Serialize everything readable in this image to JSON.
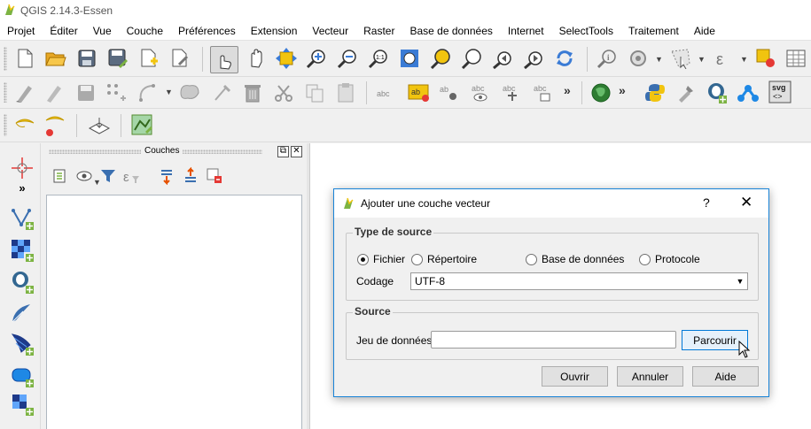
{
  "window": {
    "title": "QGIS 2.14.3-Essen"
  },
  "menubar": {
    "items": [
      "Projet",
      "Éditer",
      "Vue",
      "Couche",
      "Préférences",
      "Extension",
      "Vecteur",
      "Raster",
      "Base de données",
      "Internet",
      "SelectTools",
      "Traitement",
      "Aide"
    ]
  },
  "toolbar1": {
    "icons": [
      "new-project-icon",
      "open-project-icon",
      "save-project-icon",
      "save-as-icon",
      "new-print-composer-icon",
      "composer-manager-icon",
      "touch-zoom-icon",
      "pan-icon",
      "pan-to-selection-icon",
      "zoom-in-icon",
      "zoom-out-icon",
      "zoom-native-icon",
      "zoom-full-icon",
      "zoom-selection-icon",
      "zoom-layer-icon",
      "zoom-last-icon",
      "zoom-next-icon",
      "refresh-icon",
      "identify-icon",
      "action-icon",
      "select-icon",
      "measure-icon",
      "annotation-icon",
      "attribute-table-icon"
    ]
  },
  "toolbar2": {
    "icons": [
      "current-edits-icon",
      "toggle-editing-icon",
      "save-edits-icon",
      "add-feature-icon",
      "move-feature-icon",
      "node-tool-icon",
      "delete-selected-icon",
      "cut-features-icon",
      "copy-features-icon",
      "paste-features-icon",
      "label-icon",
      "label-highlight-icon",
      "pin-label-icon",
      "show-hide-label-icon",
      "move-label-icon",
      "change-label-icon",
      "globe-icon",
      "python-icon",
      "plugin-icon",
      "postgis-icon",
      "network-icon",
      "svg-icon"
    ],
    "svg_label": "svg"
  },
  "toolbar3": {
    "icons": [
      "add-ring-icon",
      "add-part-icon",
      "digitize-icon",
      "georeferencer-icon"
    ]
  },
  "left_toolbar": {
    "icons": [
      "crosshair-icon",
      "expand-icon",
      "add-vector-layer-icon",
      "add-raster-layer-icon",
      "add-postgis-layer-icon",
      "add-spatialite-layer-icon",
      "add-wms-layer-icon",
      "add-wfs-layer-icon",
      "add-virtual-layer-icon"
    ]
  },
  "layers_panel": {
    "title": "Couches",
    "icons": [
      "add-group-icon",
      "manage-visibility-icon",
      "filter-legend-icon",
      "filter-expression-icon",
      "expand-all-icon",
      "collapse-all-icon",
      "remove-layer-icon"
    ]
  },
  "dialog": {
    "title": "Ajouter une couche vecteur",
    "help": "?",
    "close": "✕",
    "source_type_group": "Type de source",
    "radios": [
      {
        "label": "Fichier",
        "checked": true
      },
      {
        "label": "Répertoire",
        "checked": false
      },
      {
        "label": "Base de données",
        "checked": false
      },
      {
        "label": "Protocole",
        "checked": false
      }
    ],
    "encoding_label": "Codage",
    "encoding_value": "UTF-8",
    "source_group": "Source",
    "dataset_label": "Jeu de données",
    "dataset_value": "",
    "browse_button": "Parcourir",
    "buttons": {
      "open": "Ouvrir",
      "cancel": "Annuler",
      "help": "Aide"
    }
  },
  "colors": {
    "accent": "#0078d7",
    "qgis_green": "#7cb342",
    "qgis_yellow": "#f1c40f"
  }
}
